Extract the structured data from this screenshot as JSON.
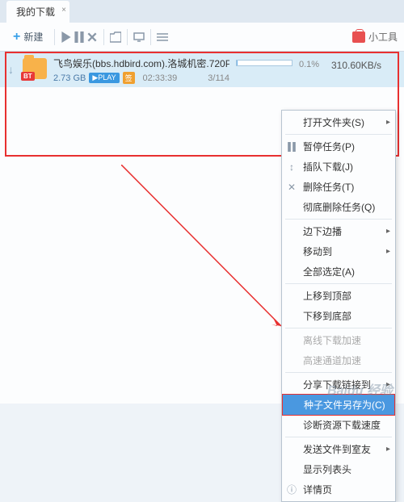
{
  "tab": {
    "title": "我的下载"
  },
  "toolbar": {
    "new_label": "新建",
    "tools_label": "小工具"
  },
  "download": {
    "name": "飞鸟娱乐(bbs.hdbird.com).洛城机密.720P....",
    "size": "2.73 GB",
    "play_tag": "▶PLAY",
    "bt_tag": "BT",
    "cert_tag": "签",
    "time": "02:33:39",
    "count": "3/114",
    "percent": "0.1%",
    "speed": "310.60KB/s"
  },
  "menu": {
    "open_folder": "打开文件夹(S)",
    "pause": "暂停任务(P)",
    "insert": "插队下载(J)",
    "delete": "删除任务(T)",
    "delete_full": "彻底删除任务(Q)",
    "play_around": "边下边播",
    "move_to": "移动到",
    "select_all": "全部选定(A)",
    "move_top": "上移到顶部",
    "move_bottom": "下移到底部",
    "offline_speed": "离线下载加速",
    "channel_speed": "高速通道加速",
    "share_link": "分享下载链接到",
    "save_torrent": "种子文件另存为(C)",
    "diagnose": "诊断资源下载速度",
    "send_file": "发送文件到室友",
    "show_list": "显示列表头",
    "details": "详情页"
  },
  "watermark": "Baidu 经验"
}
